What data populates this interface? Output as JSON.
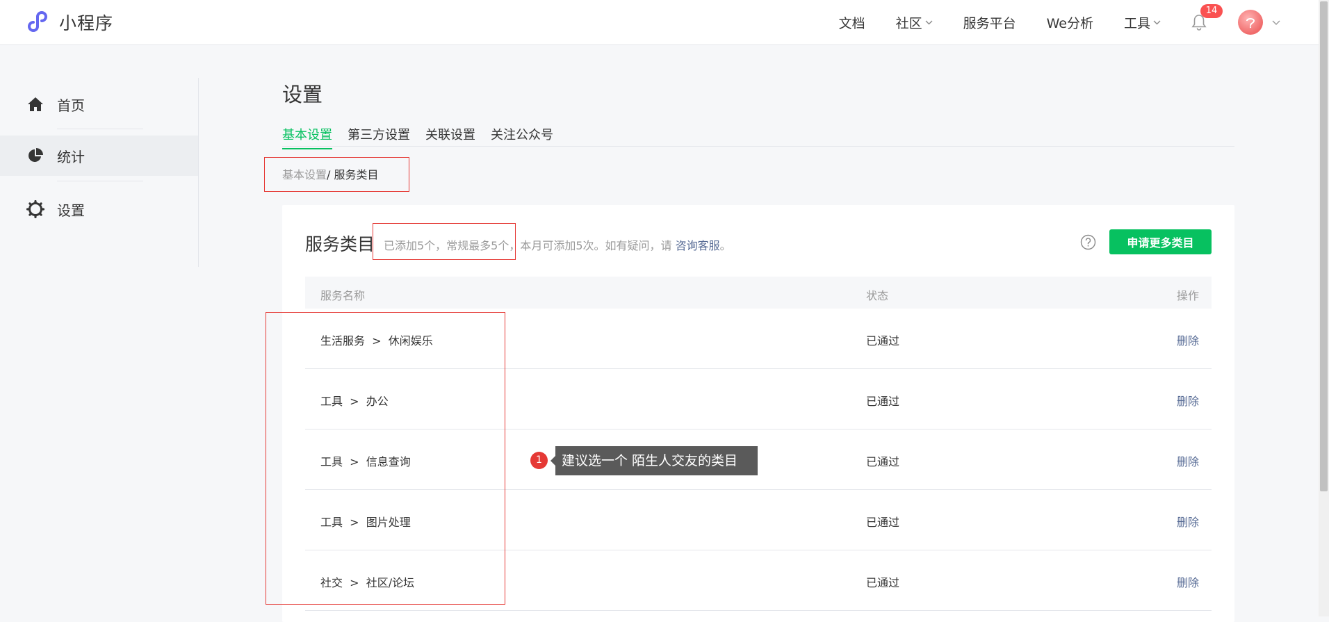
{
  "header": {
    "logo_text": "小程序",
    "nav": [
      {
        "label": "文档",
        "has_dropdown": false
      },
      {
        "label": "社区",
        "has_dropdown": true
      },
      {
        "label": "服务平台",
        "has_dropdown": false
      },
      {
        "label": "We分析",
        "has_dropdown": false
      },
      {
        "label": "工具",
        "has_dropdown": true
      }
    ],
    "notification_count": "14",
    "notification_icon": "bell-icon",
    "avatar_icon": "avatar"
  },
  "sidebar": {
    "items": [
      {
        "label": "首页",
        "icon": "home-icon",
        "active": false
      },
      {
        "label": "统计",
        "icon": "pie-chart-icon",
        "active": true
      },
      {
        "label": "设置",
        "icon": "gear-icon",
        "active": false
      }
    ]
  },
  "main": {
    "title": "设置",
    "tabs": [
      {
        "label": "基本设置",
        "active": true
      },
      {
        "label": "第三方设置",
        "active": false
      },
      {
        "label": "关联设置",
        "active": false
      },
      {
        "label": "关注公众号",
        "active": false
      }
    ],
    "breadcrumb": {
      "parent": "基本设置",
      "separator": "/ ",
      "current": "服务类目"
    }
  },
  "card": {
    "title": "服务类目",
    "desc_prefix": "已添加5个，常规最多5个，本月可添加5次。如有疑问，请 ",
    "desc_link": "咨询客服",
    "desc_suffix": "。",
    "apply_button": "申请更多类目",
    "columns": {
      "name": "服务名称",
      "status": "状态",
      "action": "操作"
    },
    "rows": [
      {
        "name": "生活服务  >  休闲娱乐",
        "status": "已通过",
        "action": "删除"
      },
      {
        "name": "工具  >  办公",
        "status": "已通过",
        "action": "删除"
      },
      {
        "name": "工具  >  信息查询",
        "status": "已通过",
        "action": "删除"
      },
      {
        "name": "工具  >  图片处理",
        "status": "已通过",
        "action": "删除"
      },
      {
        "name": "社交  >  社区/论坛",
        "status": "已通过",
        "action": "删除"
      }
    ]
  },
  "annotation": {
    "number": "1",
    "text": "建议选一个 陌生人交友的类目"
  },
  "colors": {
    "accent": "#07c160",
    "link": "#576b95",
    "badge": "#fa5151",
    "annotation": "#e53935"
  }
}
